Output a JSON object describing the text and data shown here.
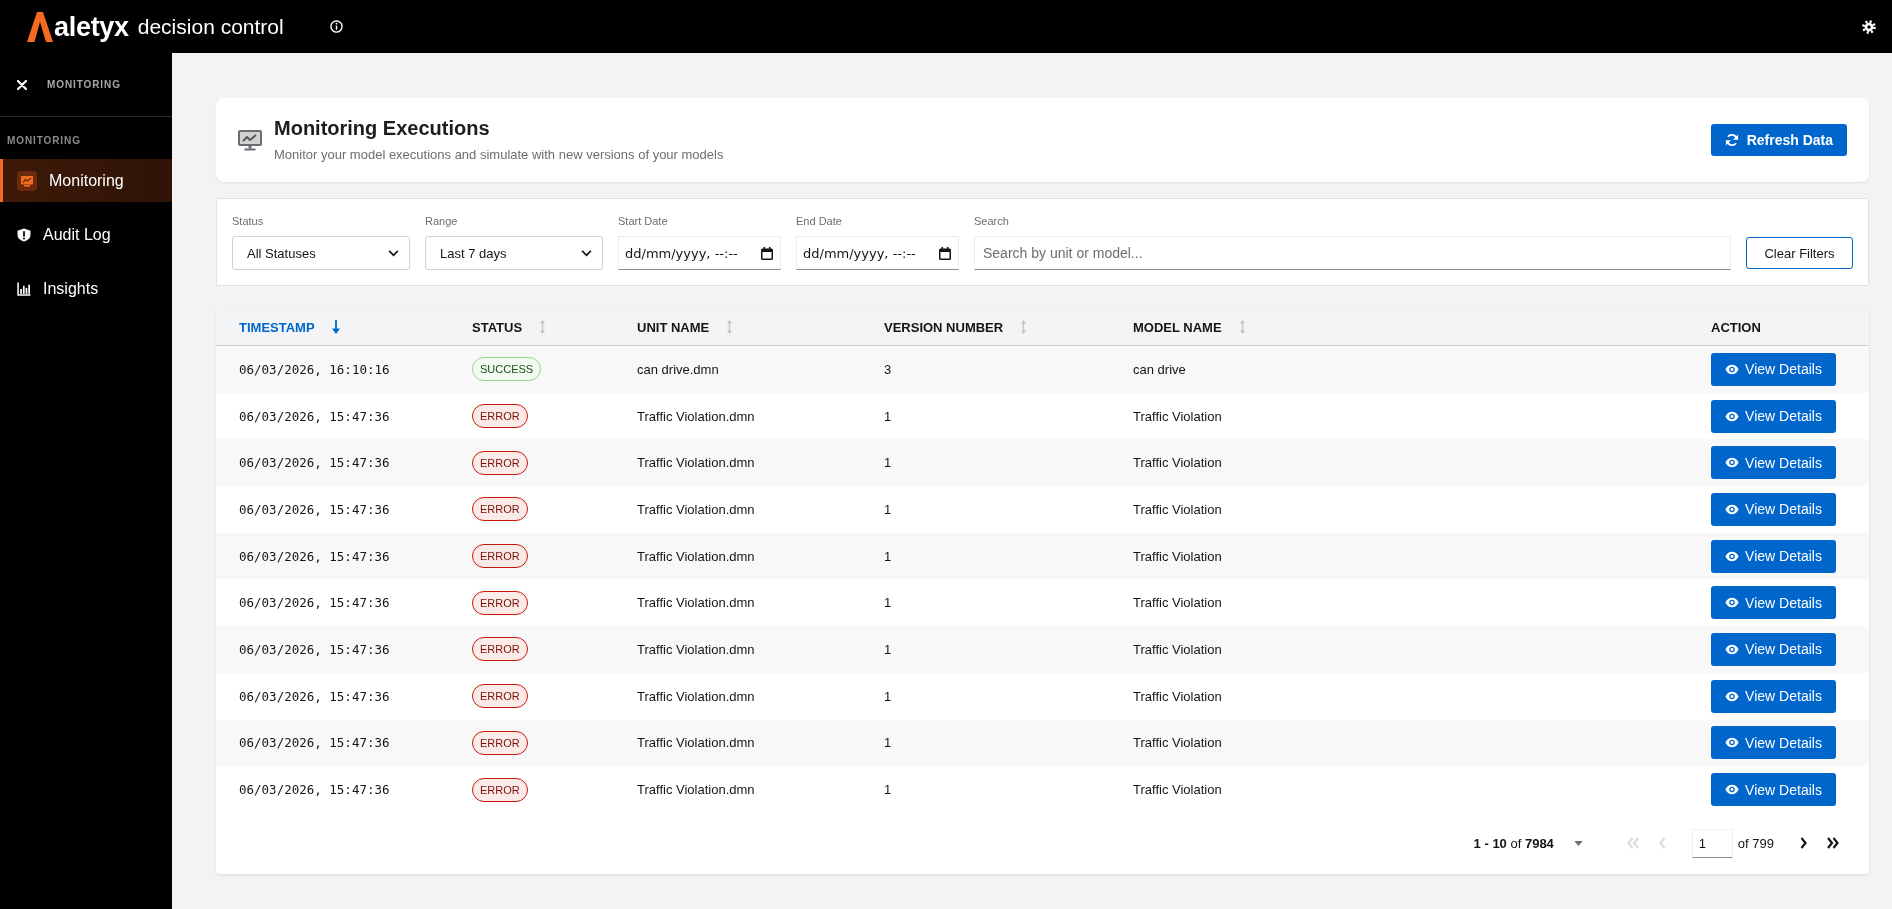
{
  "topbar": {
    "brand": "aletyx",
    "product": "decision control"
  },
  "sidebar": {
    "header": "MONITORING",
    "section": "MONITORING",
    "items": [
      {
        "label": "Monitoring",
        "selected": true
      },
      {
        "label": "Audit Log",
        "selected": false
      },
      {
        "label": "Insights",
        "selected": false
      }
    ]
  },
  "page_header": {
    "title": "Monitoring Executions",
    "subtitle": "Monitor your model executions and simulate with new versions of your models",
    "button": "Refresh Data"
  },
  "filters": {
    "fields": [
      {
        "kind": "select",
        "label": "Status",
        "value": "All Statuses"
      },
      {
        "kind": "select",
        "label": "Range",
        "value": "Last 7 days"
      },
      {
        "kind": "date",
        "label": "Start Date",
        "placeholder": "dd/mm/yyyy, --:--"
      },
      {
        "kind": "date",
        "label": "End Date",
        "placeholder": "dd/mm/yyyy, --:--"
      },
      {
        "kind": "text",
        "label": "Search",
        "placeholder": "Search by unit or model..."
      }
    ],
    "clear_button": "Clear Filters"
  },
  "table": {
    "columns": [
      {
        "label": "TIMESTAMP",
        "sortable": true,
        "selected": true
      },
      {
        "label": "STATUS",
        "sortable": true,
        "selected": false
      },
      {
        "label": "UNIT NAME",
        "sortable": true,
        "selected": false
      },
      {
        "label": "VERSION NUMBER",
        "sortable": true,
        "selected": false
      },
      {
        "label": "MODEL NAME",
        "sortable": true,
        "selected": false
      },
      {
        "label": "ACTION",
        "sortable": false,
        "selected": false
      }
    ],
    "rows": [
      {
        "timestamp": "06/03/2026, 16:10:16",
        "status": {
          "label": "SUCCESS",
          "kind": "success"
        },
        "unit_name": "can drive.dmn",
        "version": "3",
        "model_name": "can drive",
        "action": "View Details"
      },
      {
        "timestamp": "06/03/2026, 15:47:36",
        "status": {
          "label": "ERROR",
          "kind": "error"
        },
        "unit_name": "Traffic Violation.dmn",
        "version": "1",
        "model_name": "Traffic Violation",
        "action": "View Details"
      },
      {
        "timestamp": "06/03/2026, 15:47:36",
        "status": {
          "label": "ERROR",
          "kind": "error"
        },
        "unit_name": "Traffic Violation.dmn",
        "version": "1",
        "model_name": "Traffic Violation",
        "action": "View Details"
      },
      {
        "timestamp": "06/03/2026, 15:47:36",
        "status": {
          "label": "ERROR",
          "kind": "error"
        },
        "unit_name": "Traffic Violation.dmn",
        "version": "1",
        "model_name": "Traffic Violation",
        "action": "View Details"
      },
      {
        "timestamp": "06/03/2026, 15:47:36",
        "status": {
          "label": "ERROR",
          "kind": "error"
        },
        "unit_name": "Traffic Violation.dmn",
        "version": "1",
        "model_name": "Traffic Violation",
        "action": "View Details"
      },
      {
        "timestamp": "06/03/2026, 15:47:36",
        "status": {
          "label": "ERROR",
          "kind": "error"
        },
        "unit_name": "Traffic Violation.dmn",
        "version": "1",
        "model_name": "Traffic Violation",
        "action": "View Details"
      },
      {
        "timestamp": "06/03/2026, 15:47:36",
        "status": {
          "label": "ERROR",
          "kind": "error"
        },
        "unit_name": "Traffic Violation.dmn",
        "version": "1",
        "model_name": "Traffic Violation",
        "action": "View Details"
      },
      {
        "timestamp": "06/03/2026, 15:47:36",
        "status": {
          "label": "ERROR",
          "kind": "error"
        },
        "unit_name": "Traffic Violation.dmn",
        "version": "1",
        "model_name": "Traffic Violation",
        "action": "View Details"
      },
      {
        "timestamp": "06/03/2026, 15:47:36",
        "status": {
          "label": "ERROR",
          "kind": "error"
        },
        "unit_name": "Traffic Violation.dmn",
        "version": "1",
        "model_name": "Traffic Violation",
        "action": "View Details"
      },
      {
        "timestamp": "06/03/2026, 15:47:36",
        "status": {
          "label": "ERROR",
          "kind": "error"
        },
        "unit_name": "Traffic Violation.dmn",
        "version": "1",
        "model_name": "Traffic Violation",
        "action": "View Details"
      }
    ]
  },
  "pagination": {
    "range": "**1 - 10** of **7984**",
    "page": "1",
    "page_count": "of 799",
    "nav": [
      {
        "kind": "first",
        "disabled": true
      },
      {
        "kind": "previous",
        "disabled": true
      },
      {
        "kind": "next",
        "disabled": false
      },
      {
        "kind": "last",
        "disabled": false
      }
    ]
  }
}
